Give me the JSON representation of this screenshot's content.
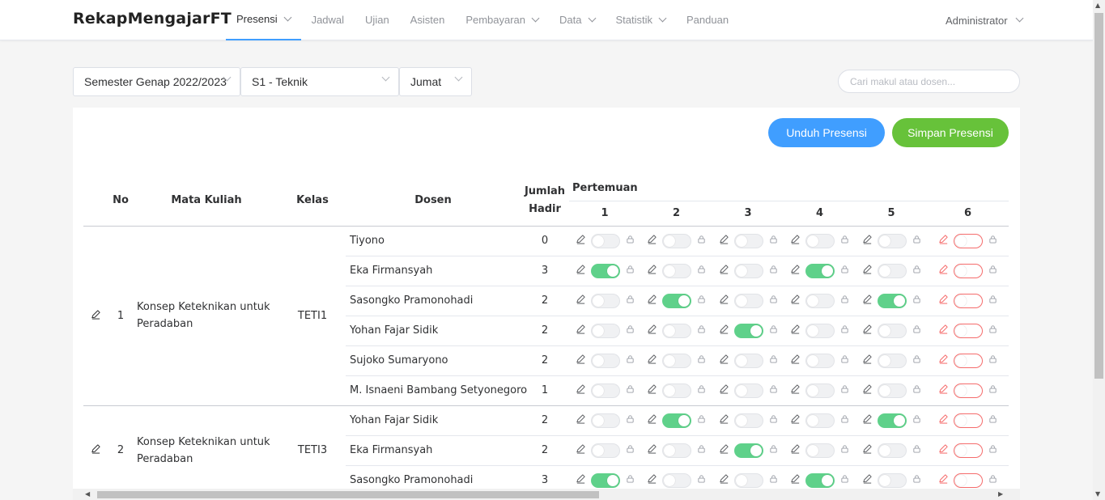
{
  "brand": "RekapMengajarFT",
  "nav": [
    {
      "label": "Presensi",
      "dropdown": true,
      "active": true
    },
    {
      "label": "Jadwal",
      "dropdown": false
    },
    {
      "label": "Ujian",
      "dropdown": false
    },
    {
      "label": "Asisten",
      "dropdown": false
    },
    {
      "label": "Pembayaran",
      "dropdown": true
    },
    {
      "label": "Data",
      "dropdown": true
    },
    {
      "label": "Statistik",
      "dropdown": true
    },
    {
      "label": "Panduan",
      "dropdown": false
    }
  ],
  "user": "Administrator",
  "filters": {
    "semester": "Semester Genap 2022/2023",
    "prodi": "S1 - Teknik",
    "hari": "Jumat",
    "search_placeholder": "Cari makul atau dosen..."
  },
  "actions": {
    "download": "Unduh Presensi",
    "save": "Simpan Presensi"
  },
  "table": {
    "headers": {
      "no": "No",
      "course": "Mata Kuliah",
      "class": "Kelas",
      "lecturer": "Dosen",
      "total_l1": "Jumlah",
      "total_l2": "Hadir",
      "meetings": "Pertemuan"
    },
    "meeting_numbers": [
      "1",
      "2",
      "3",
      "4",
      "5",
      "6"
    ],
    "groups": [
      {
        "no": "1",
        "course": "Konsep Keteknikan untuk Peradaban",
        "class": "TETI1",
        "rows": [
          {
            "lecturer": "Tiyono",
            "total": "0",
            "attend": [
              0,
              0,
              0,
              0,
              0,
              0
            ]
          },
          {
            "lecturer": "Eka Firmansyah",
            "total": "3",
            "attend": [
              1,
              0,
              0,
              1,
              0,
              0
            ]
          },
          {
            "lecturer": "Sasongko Pramonohadi",
            "total": "2",
            "attend": [
              0,
              1,
              0,
              0,
              1,
              0
            ]
          },
          {
            "lecturer": "Yohan Fajar Sidik",
            "total": "2",
            "attend": [
              0,
              0,
              1,
              0,
              0,
              0
            ]
          },
          {
            "lecturer": "Sujoko Sumaryono",
            "total": "2",
            "attend": [
              0,
              0,
              0,
              0,
              0,
              0
            ]
          },
          {
            "lecturer": "M. Isnaeni Bambang Setyonegoro",
            "total": "1",
            "attend": [
              0,
              0,
              0,
              0,
              0,
              0
            ]
          }
        ]
      },
      {
        "no": "2",
        "course": "Konsep Keteknikan untuk Peradaban",
        "class": "TETI3",
        "rows": [
          {
            "lecturer": "Yohan Fajar Sidik",
            "total": "2",
            "attend": [
              0,
              1,
              0,
              0,
              1,
              0
            ]
          },
          {
            "lecturer": "Eka Firmansyah",
            "total": "2",
            "attend": [
              0,
              0,
              1,
              0,
              0,
              0
            ]
          },
          {
            "lecturer": "Sasongko Pramonohadi",
            "total": "3",
            "attend": [
              1,
              0,
              0,
              1,
              0,
              0
            ]
          }
        ]
      }
    ]
  },
  "colors": {
    "primary": "#409eff",
    "success": "#67c23a",
    "switch_on": "#5fd18a",
    "danger": "#f56c6c"
  }
}
